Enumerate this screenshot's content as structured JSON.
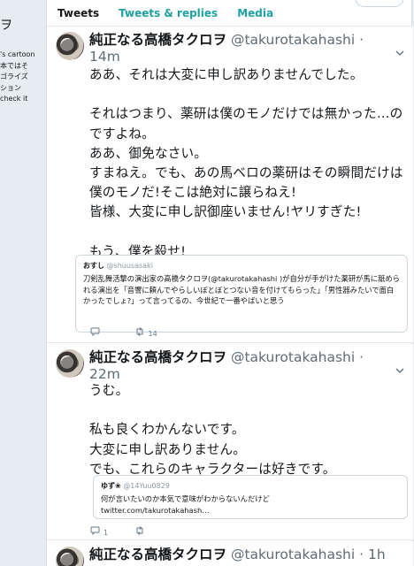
{
  "left_strip": {
    "glyph": "ヲ",
    "lines": [
      "'s cartoon",
      "本ではそ",
      "ゴライズ",
      "ション",
      "check it"
    ]
  },
  "tabs": [
    {
      "label": "Tweets"
    },
    {
      "label": "Tweets & replies"
    },
    {
      "label": "Media"
    }
  ],
  "tweets": [
    {
      "name": "純正なる高橋タクロヲ",
      "handle": "@takurotakahashi",
      "time_sep": " ·",
      "time": "14m",
      "text": "ああ、それは大変に申し訳ありませんでした。\n\nそれはつまり、薬研は僕のモノだけでは無かった…のですよね。\nああ、御免なさい。\nすまねえ。でも、あの馬ベロの薬研はその瞬間だけは僕のモノだ!そこは絶対に譲らねえ!\n皆様、大変に申し訳御座いません!ヤリすぎた!\n\nもう、僕を殺せ!",
      "quote": {
        "name": "おすし",
        "handle": "@shuusasaki",
        "text": "刀剣乱舞活撃の演出家の高橋タクロヲ(@takurotakahashi )が自分が手がけた薬研が馬に舐められる演出を「音響に頼んでやらしいぼとぼとつない音を付けてもらった」「男性器みたいで面白かったでしょ?」って言ってるの、今世紀で一番やばいと思う"
      },
      "reply_count": "",
      "retweet_count": "14"
    },
    {
      "name": "純正なる高橋タクロヲ",
      "handle": "@takurotakahashi",
      "time_sep": " ·",
      "time": "22m",
      "text": "うむ。\n\n私も良くわかんないです。\n大変に申し訳ありません。\nでも、これらのキャラクターは好きです。",
      "quote": {
        "name": "ゆず❀",
        "handle": "@14Yuu0829",
        "text": "何が言いたいのか本気で意味がわからないんだけど\ntwitter.com/takurotakahash…"
      },
      "reply_count": "1",
      "retweet_count": ""
    },
    {
      "name": "純正なる高橋タクロヲ",
      "handle": "@takurotakahashi",
      "time_sep": " · ",
      "time": "1h"
    }
  ]
}
